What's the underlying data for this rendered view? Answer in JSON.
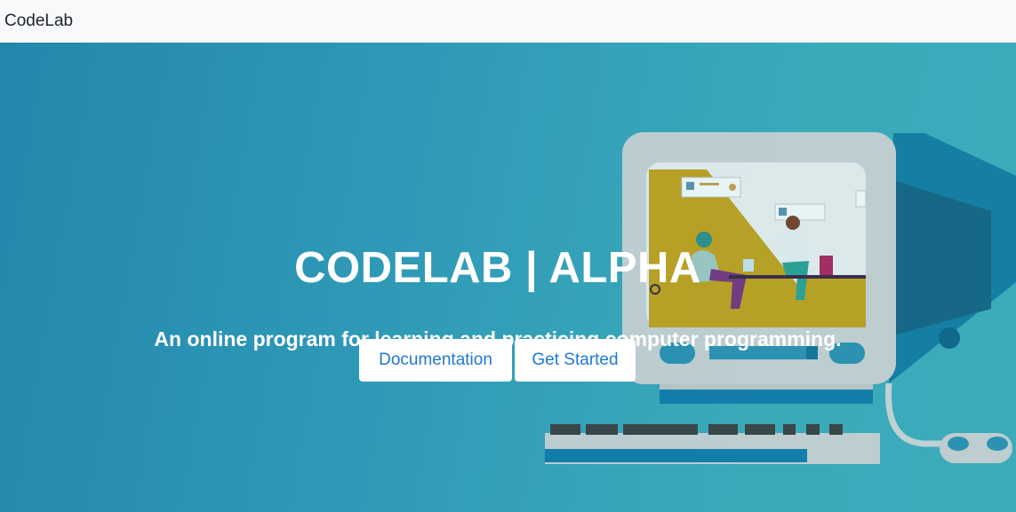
{
  "navbar": {
    "brand": "CodeLab"
  },
  "hero": {
    "title": "CODELAB | ALPHA",
    "subtitle": "An online program for learning and practicing computer programming.",
    "buttons": {
      "documentation": "Documentation",
      "get_started": "Get Started"
    }
  },
  "colors": {
    "navbar_bg": "#f8f9fa",
    "hero_gradient_start": "#2487ad",
    "hero_gradient_end": "#3cabba",
    "button_text": "#1e78d6",
    "hero_text": "#ffffff"
  },
  "illustration": {
    "icon": "retro-computer-illustration"
  }
}
